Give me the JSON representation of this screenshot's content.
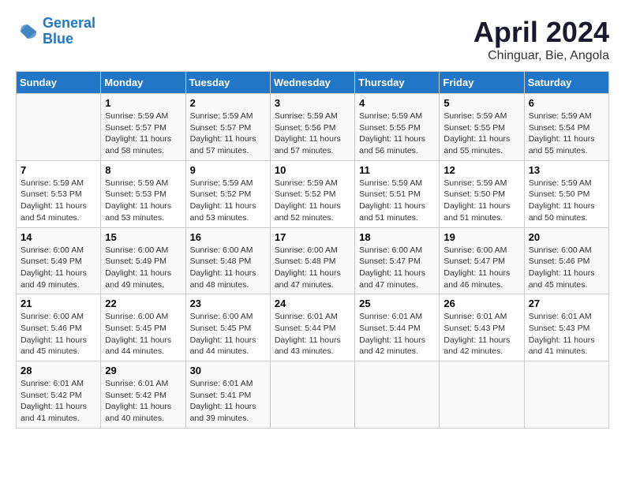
{
  "header": {
    "logo_line1": "General",
    "logo_line2": "Blue",
    "title": "April 2024",
    "subtitle": "Chinguar, Bie, Angola"
  },
  "columns": [
    "Sunday",
    "Monday",
    "Tuesday",
    "Wednesday",
    "Thursday",
    "Friday",
    "Saturday"
  ],
  "weeks": [
    [
      {
        "day": "",
        "info": ""
      },
      {
        "day": "1",
        "info": "Sunrise: 5:59 AM\nSunset: 5:57 PM\nDaylight: 11 hours\nand 58 minutes."
      },
      {
        "day": "2",
        "info": "Sunrise: 5:59 AM\nSunset: 5:57 PM\nDaylight: 11 hours\nand 57 minutes."
      },
      {
        "day": "3",
        "info": "Sunrise: 5:59 AM\nSunset: 5:56 PM\nDaylight: 11 hours\nand 57 minutes."
      },
      {
        "day": "4",
        "info": "Sunrise: 5:59 AM\nSunset: 5:55 PM\nDaylight: 11 hours\nand 56 minutes."
      },
      {
        "day": "5",
        "info": "Sunrise: 5:59 AM\nSunset: 5:55 PM\nDaylight: 11 hours\nand 55 minutes."
      },
      {
        "day": "6",
        "info": "Sunrise: 5:59 AM\nSunset: 5:54 PM\nDaylight: 11 hours\nand 55 minutes."
      }
    ],
    [
      {
        "day": "7",
        "info": "Sunrise: 5:59 AM\nSunset: 5:53 PM\nDaylight: 11 hours\nand 54 minutes."
      },
      {
        "day": "8",
        "info": "Sunrise: 5:59 AM\nSunset: 5:53 PM\nDaylight: 11 hours\nand 53 minutes."
      },
      {
        "day": "9",
        "info": "Sunrise: 5:59 AM\nSunset: 5:52 PM\nDaylight: 11 hours\nand 53 minutes."
      },
      {
        "day": "10",
        "info": "Sunrise: 5:59 AM\nSunset: 5:52 PM\nDaylight: 11 hours\nand 52 minutes."
      },
      {
        "day": "11",
        "info": "Sunrise: 5:59 AM\nSunset: 5:51 PM\nDaylight: 11 hours\nand 51 minutes."
      },
      {
        "day": "12",
        "info": "Sunrise: 5:59 AM\nSunset: 5:50 PM\nDaylight: 11 hours\nand 51 minutes."
      },
      {
        "day": "13",
        "info": "Sunrise: 5:59 AM\nSunset: 5:50 PM\nDaylight: 11 hours\nand 50 minutes."
      }
    ],
    [
      {
        "day": "14",
        "info": "Sunrise: 6:00 AM\nSunset: 5:49 PM\nDaylight: 11 hours\nand 49 minutes."
      },
      {
        "day": "15",
        "info": "Sunrise: 6:00 AM\nSunset: 5:49 PM\nDaylight: 11 hours\nand 49 minutes."
      },
      {
        "day": "16",
        "info": "Sunrise: 6:00 AM\nSunset: 5:48 PM\nDaylight: 11 hours\nand 48 minutes."
      },
      {
        "day": "17",
        "info": "Sunrise: 6:00 AM\nSunset: 5:48 PM\nDaylight: 11 hours\nand 47 minutes."
      },
      {
        "day": "18",
        "info": "Sunrise: 6:00 AM\nSunset: 5:47 PM\nDaylight: 11 hours\nand 47 minutes."
      },
      {
        "day": "19",
        "info": "Sunrise: 6:00 AM\nSunset: 5:47 PM\nDaylight: 11 hours\nand 46 minutes."
      },
      {
        "day": "20",
        "info": "Sunrise: 6:00 AM\nSunset: 5:46 PM\nDaylight: 11 hours\nand 45 minutes."
      }
    ],
    [
      {
        "day": "21",
        "info": "Sunrise: 6:00 AM\nSunset: 5:46 PM\nDaylight: 11 hours\nand 45 minutes."
      },
      {
        "day": "22",
        "info": "Sunrise: 6:00 AM\nSunset: 5:45 PM\nDaylight: 11 hours\nand 44 minutes."
      },
      {
        "day": "23",
        "info": "Sunrise: 6:00 AM\nSunset: 5:45 PM\nDaylight: 11 hours\nand 44 minutes."
      },
      {
        "day": "24",
        "info": "Sunrise: 6:01 AM\nSunset: 5:44 PM\nDaylight: 11 hours\nand 43 minutes."
      },
      {
        "day": "25",
        "info": "Sunrise: 6:01 AM\nSunset: 5:44 PM\nDaylight: 11 hours\nand 42 minutes."
      },
      {
        "day": "26",
        "info": "Sunrise: 6:01 AM\nSunset: 5:43 PM\nDaylight: 11 hours\nand 42 minutes."
      },
      {
        "day": "27",
        "info": "Sunrise: 6:01 AM\nSunset: 5:43 PM\nDaylight: 11 hours\nand 41 minutes."
      }
    ],
    [
      {
        "day": "28",
        "info": "Sunrise: 6:01 AM\nSunset: 5:42 PM\nDaylight: 11 hours\nand 41 minutes."
      },
      {
        "day": "29",
        "info": "Sunrise: 6:01 AM\nSunset: 5:42 PM\nDaylight: 11 hours\nand 40 minutes."
      },
      {
        "day": "30",
        "info": "Sunrise: 6:01 AM\nSunset: 5:41 PM\nDaylight: 11 hours\nand 39 minutes."
      },
      {
        "day": "",
        "info": ""
      },
      {
        "day": "",
        "info": ""
      },
      {
        "day": "",
        "info": ""
      },
      {
        "day": "",
        "info": ""
      }
    ]
  ]
}
